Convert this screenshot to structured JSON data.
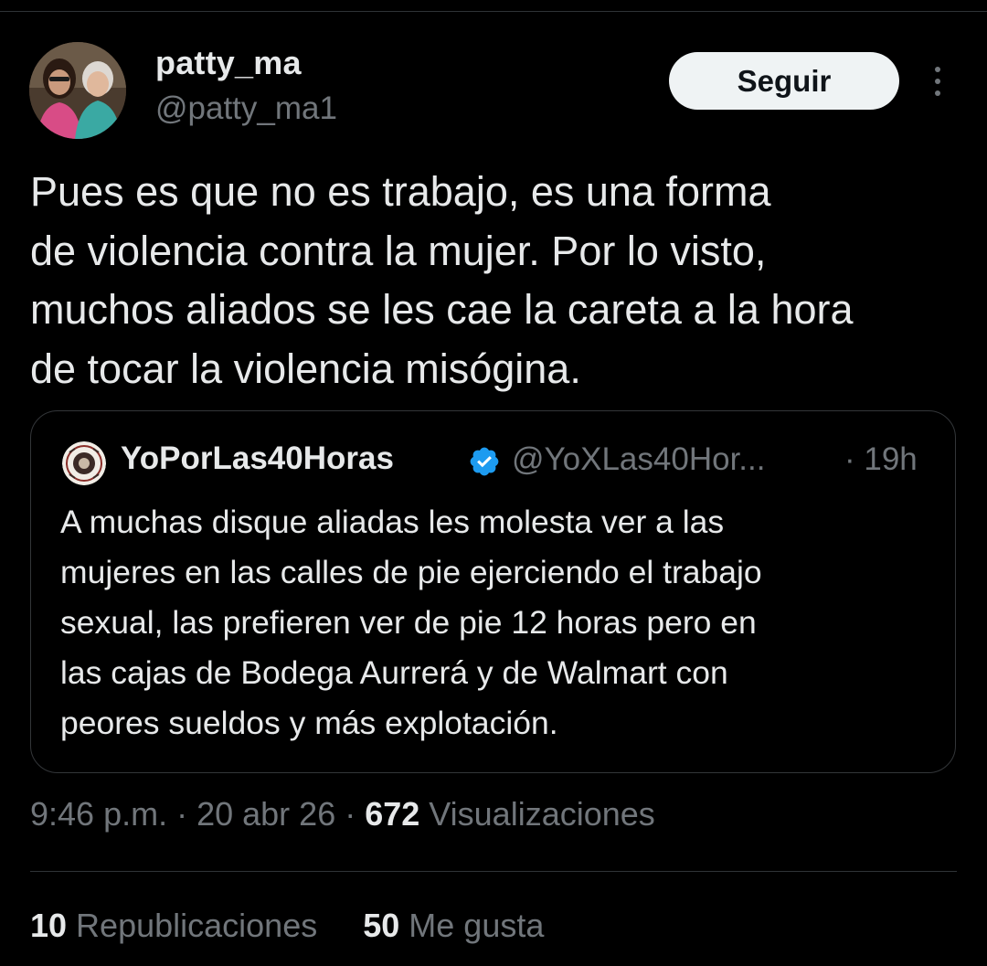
{
  "author": {
    "display_name": "patty_ma",
    "handle": "@patty_ma1",
    "follow_label": "Seguir",
    "more_icon": "more-vertical-icon"
  },
  "tweet": {
    "lines": [
      "Pues es que no es trabajo, es una forma",
      "de violencia contra la mujer. Por lo visto,",
      "muchos aliados se les cae la careta a la hora",
      "de tocar la violencia misógina."
    ]
  },
  "quote": {
    "display_name": "YoPorLas40Horas",
    "verified_icon": "verified-badge-icon",
    "handle": "@YoXLas40Hor...",
    "time": "· 19h",
    "lines": [
      "A muchas disque aliadas les molesta ver a las",
      "mujeres en las calles de pie ejerciendo el trabajo",
      "sexual, las prefieren ver de pie 12 horas pero en",
      "las cajas de Bodega Aurrerá y de Walmart con",
      "peores sueldos y más explotación."
    ]
  },
  "meta": {
    "time": "9:46 p.m.",
    "sep1": " · ",
    "date": "20 abr 26",
    "sep2": " · ",
    "views_count": "672",
    "views_label": " Visualizaciones"
  },
  "stats": {
    "reposts_count": "10",
    "reposts_label": " Republicaciones",
    "likes_count": "50",
    "likes_label": " Me gusta"
  },
  "colors": {
    "background": "#000000",
    "text_primary": "#e7e9ea",
    "text_secondary": "#71767b",
    "border": "#2f3336",
    "verified_blue": "#1d9bf0",
    "follow_bg": "#eff3f4"
  }
}
